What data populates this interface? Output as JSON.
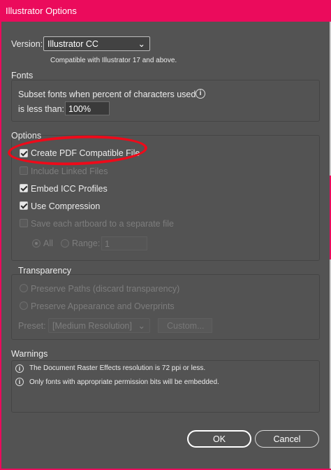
{
  "window": {
    "title": "Illustrator Options"
  },
  "version": {
    "label": "Version:",
    "selected": "Illustrator CC",
    "compat_note": "Compatible with Illustrator 17 and above."
  },
  "fonts": {
    "legend": "Fonts",
    "text_line1": "Subset fonts when percent of characters used",
    "text_line2": "is less than:",
    "percent_value": "100%"
  },
  "options": {
    "legend": "Options",
    "items": [
      {
        "label": "Create PDF Compatible File",
        "checked": true,
        "enabled": true
      },
      {
        "label": "Include Linked Files",
        "checked": false,
        "enabled": false
      },
      {
        "label": "Embed ICC Profiles",
        "checked": true,
        "enabled": true
      },
      {
        "label": "Use Compression",
        "checked": true,
        "enabled": true
      },
      {
        "label": "Save each artboard to a separate file",
        "checked": false,
        "enabled": false
      }
    ],
    "artboard_all_label": "All",
    "artboard_range_label": "Range:",
    "range_value": "1"
  },
  "transparency": {
    "legend": "Transparency",
    "preserve_paths_label": "Preserve Paths (discard transparency)",
    "preserve_appearance_label": "Preserve Appearance and Overprints",
    "preset_label": "Preset:",
    "preset_value": "[Medium Resolution]",
    "custom_button": "Custom..."
  },
  "warnings": {
    "legend": "Warnings",
    "items": [
      "The Document Raster Effects resolution is 72 ppi or less.",
      "Only fonts with appropriate permission bits will be embedded."
    ]
  },
  "buttons": {
    "ok": "OK",
    "cancel": "Cancel"
  },
  "icons": {
    "info": "info-icon",
    "chevron": "chevron-down-icon",
    "info_glyph": "i",
    "chevron_glyph": "⌄"
  },
  "colors": {
    "titlebar": "#eb0b5c",
    "dialog_bg": "#535353",
    "annotation_circle": "#ee0a1a"
  }
}
